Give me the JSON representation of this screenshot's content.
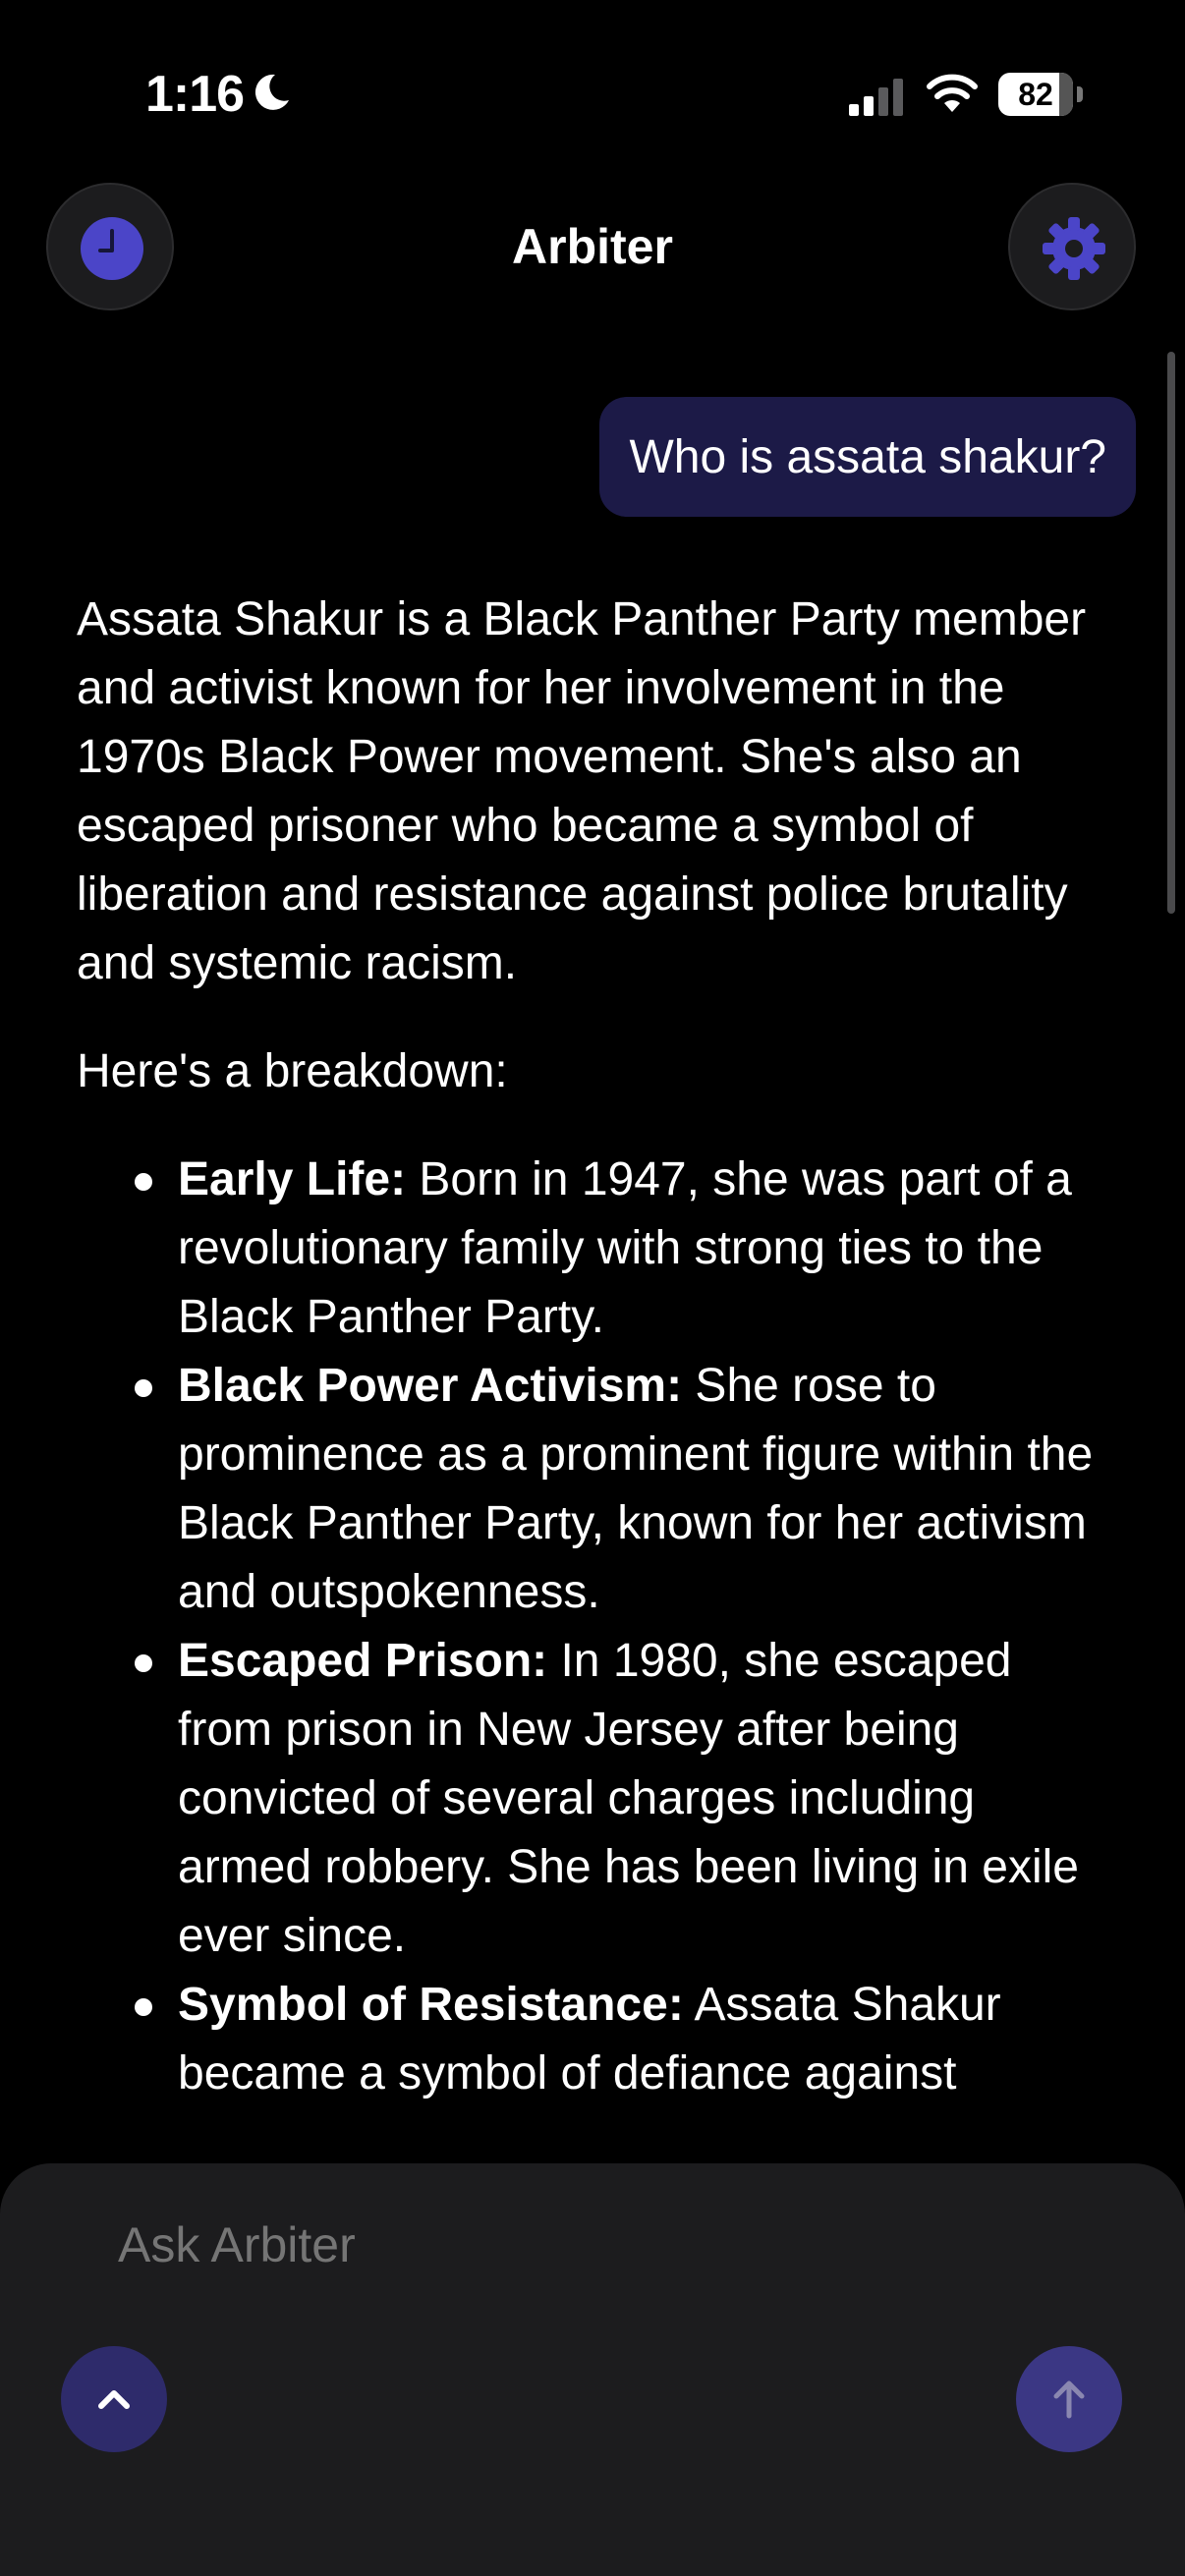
{
  "status_bar": {
    "time": "1:16",
    "battery": "82",
    "battery_level_percent": 82
  },
  "header": {
    "title": "Arbiter",
    "left_icon": "history-clock-icon",
    "right_icon": "gear-icon"
  },
  "colors": {
    "background": "#000000",
    "accent": "#4b45c8",
    "user_bubble": "#1c1a47",
    "composer": "#1c1c1e"
  },
  "chat": {
    "user_message": "Who is assata shakur?",
    "response": {
      "intro": "Assata Shakur is a Black Panther Party member and activist known for her involvement in the 1970s Black Power movement.  She's also an escaped prisoner who became a symbol of liberation and resistance against police brutality and systemic racism.",
      "breakdown_heading": "Here's a breakdown:",
      "points": [
        {
          "label": "Early Life:",
          "text": " Born in 1947, she was part of a revolutionary family with strong ties to the Black Panther Party."
        },
        {
          "label": "Black Power Activism:",
          "text": "  She rose to prominence as a prominent figure within the Black Panther Party, known for her activism and outspokenness."
        },
        {
          "label": "Escaped Prison:",
          "text": " In 1980, she escaped from prison in New Jersey after being convicted of several charges including armed robbery. She has been living in exile ever since."
        },
        {
          "label": "Symbol of Resistance:",
          "text": "  Assata Shakur became a symbol of defiance against"
        }
      ]
    }
  },
  "composer": {
    "placeholder": "Ask Arbiter",
    "expand_icon": "chevron-up-icon",
    "send_icon": "arrow-up-icon"
  }
}
